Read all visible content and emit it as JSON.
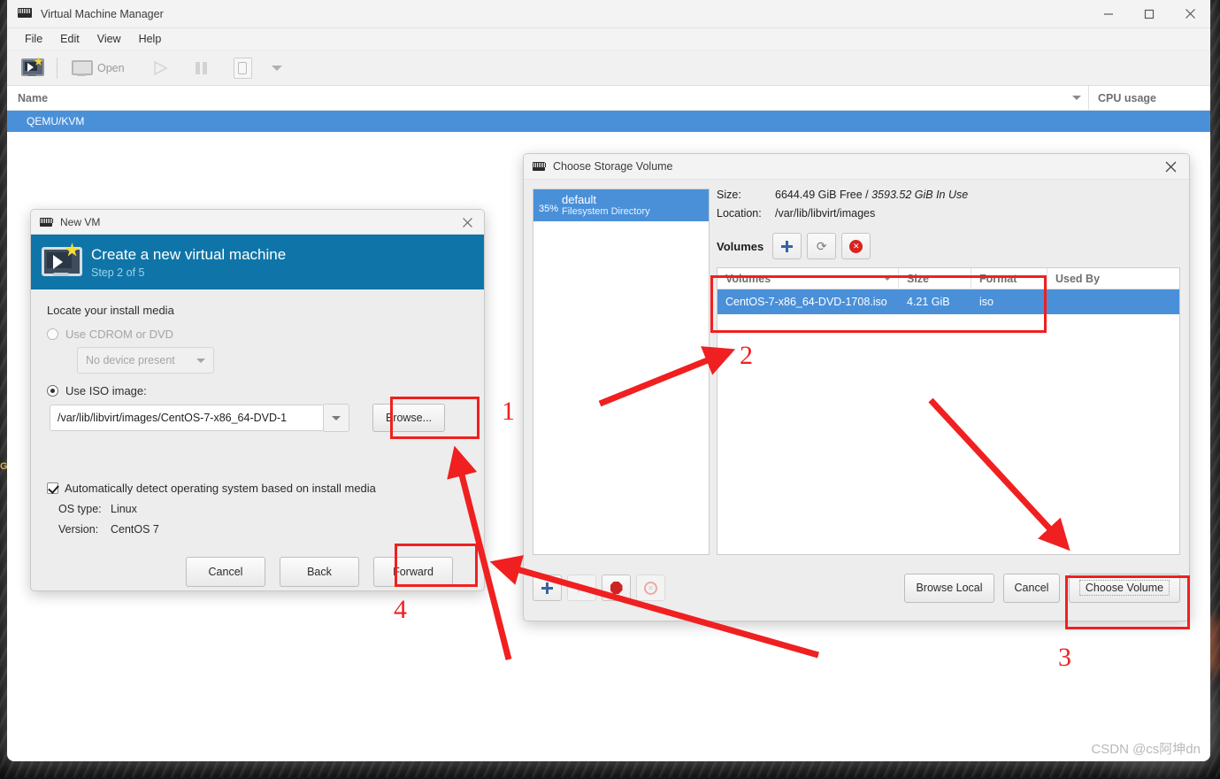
{
  "window": {
    "title": "Virtual Machine Manager",
    "icon": "vmm-icon",
    "controls": {
      "minimize": "minimize-icon",
      "maximize": "maximize-icon",
      "close": "close-icon"
    }
  },
  "menubar": {
    "items": [
      "File",
      "Edit",
      "View",
      "Help"
    ]
  },
  "toolbar": {
    "new_vm": "new-vm-icon",
    "open_label": "Open",
    "open_icon": "monitor-icon",
    "run_icon": "play-icon",
    "pause_icon": "pause-icon",
    "shutdown_icon": "shutdown-icon",
    "dropdown_icon": "chevron-down-icon"
  },
  "vm_list": {
    "columns": [
      "Name",
      "CPU usage"
    ],
    "rows": [
      {
        "name": "QEMU/KVM"
      }
    ]
  },
  "new_vm_dialog": {
    "title": "New VM",
    "close": "close-icon",
    "banner_title": "Create a new virtual machine",
    "banner_step": "Step 2 of 5",
    "section_label": "Locate your install media",
    "cdrom_option": "Use CDROM or DVD",
    "cdrom_device": "No device present",
    "iso_option": "Use ISO image:",
    "iso_path": "/var/lib/libvirt/images/CentOS-7-x86_64-DVD-1",
    "browse_label": "Browse...",
    "autodetect_label": "Automatically detect operating system based on install media",
    "os_type_key": "OS type:",
    "os_type_value": "Linux",
    "version_key": "Version:",
    "version_value": "CentOS 7",
    "cancel_label": "Cancel",
    "back_label": "Back",
    "forward_label": "Forward"
  },
  "storage_dialog": {
    "title": "Choose Storage Volume",
    "close": "close-icon",
    "pools": [
      {
        "percent": "35%",
        "name": "default",
        "type": "Filesystem Directory"
      }
    ],
    "size_key": "Size:",
    "size_value_free": "6644.49 GiB Free /",
    "size_value_inuse": "3593.52 GiB In Use",
    "location_key": "Location:",
    "location_value": "/var/lib/libvirt/images",
    "volumes_label": "Volumes",
    "vol_add_icon": "plus-icon",
    "vol_refresh_icon": "refresh-icon",
    "vol_delete_icon": "delete-icon",
    "columns": [
      "Volumes",
      "Size",
      "Format",
      "Used By"
    ],
    "rows": [
      {
        "volume": "CentOS-7-x86_64-DVD-1708.iso",
        "size": "4.21 GiB",
        "format": "iso",
        "used_by": ""
      }
    ],
    "footer_add_icon": "plus-icon",
    "footer_start_icon": "play-icon",
    "footer_stop_icon": "stop-icon",
    "footer_delete_icon": "delete-icon",
    "browse_local_label": "Browse Local",
    "cancel_label": "Cancel",
    "choose_volume_label": "Choose Volume"
  },
  "annotations": {
    "numbers": [
      "1",
      "2",
      "3",
      "4"
    ],
    "color": "#f02020"
  },
  "watermark": "CSDN @cs阿坤dn"
}
